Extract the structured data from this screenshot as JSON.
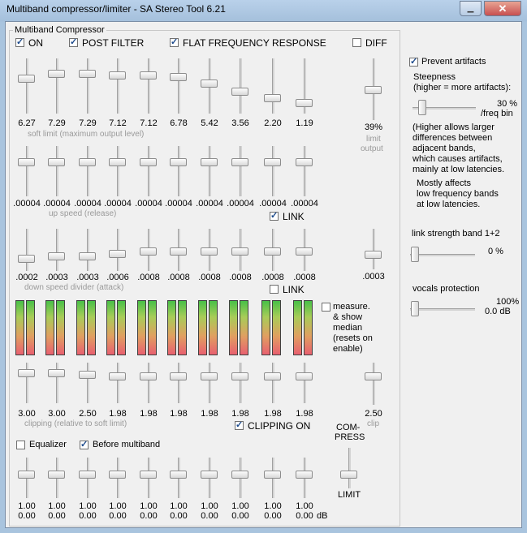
{
  "window": {
    "title": "Multiband compressor/limiter - SA Stereo Tool 6.21"
  },
  "group": {
    "title": "Multiband Compressor"
  },
  "top_checks": {
    "on": {
      "label": "ON",
      "checked": true
    },
    "post_filter": {
      "label": "POST FILTER",
      "checked": true
    },
    "flat": {
      "label": "FLAT FREQUENCY RESPONSE",
      "checked": true
    },
    "diff": {
      "label": "DIFF",
      "checked": false
    }
  },
  "soft_limit": {
    "values": [
      "6.27",
      "7.29",
      "7.29",
      "7.12",
      "7.12",
      "6.78",
      "5.42",
      "3.56",
      "2.20",
      "1.19"
    ],
    "caption": "soft limit (maximum output level)",
    "limit_output_value": "39%",
    "limit_output_caption_1": "limit",
    "limit_output_caption_2": "output"
  },
  "up_speed": {
    "values": [
      ".00004",
      ".00004",
      ".00004",
      ".00004",
      ".00004",
      ".00004",
      ".00004",
      ".00004",
      ".00004",
      ".00004"
    ],
    "caption": "up speed (release)",
    "link_label": "LINK",
    "link_checked": true
  },
  "down_speed": {
    "values": [
      ".0002",
      ".0003",
      ".0003",
      ".0006",
      ".0008",
      ".0008",
      ".0008",
      ".0008",
      ".0008",
      ".0008"
    ],
    "caption": "down speed divider (attack)",
    "extra_value": ".0003",
    "link_label": "LINK",
    "link_checked": false
  },
  "meters": {
    "measure_label_lines": [
      "measure.",
      "& show",
      "median",
      "(resets on",
      "enable)"
    ],
    "measure_checked": false
  },
  "clipping": {
    "values": [
      "3.00",
      "3.00",
      "2.50",
      "1.98",
      "1.98",
      "1.98",
      "1.98",
      "1.98",
      "1.98",
      "1.98"
    ],
    "caption": "clipping (relative to soft limit)",
    "clip_value": "2.50",
    "clip_caption": "clip",
    "clipping_on_label": "CLIPPING ON",
    "clipping_on_checked": true,
    "compress_label_1": "COM-",
    "compress_label_2": "PRESS",
    "limit_label": "LIMIT"
  },
  "equalizer": {
    "eq_label": "Equalizer",
    "eq_checked": false,
    "before_label": "Before multiband",
    "before_checked": true,
    "values_top": [
      "1.00",
      "1.00",
      "1.00",
      "1.00",
      "1.00",
      "1.00",
      "1.00",
      "1.00",
      "1.00",
      "1.00"
    ],
    "values_bottom": [
      "0.00",
      "0.00",
      "0.00",
      "0.00",
      "0.00",
      "0.00",
      "0.00",
      "0.00",
      "0.00",
      "0.00"
    ],
    "unit": "dB"
  },
  "right_panel": {
    "prevent_label": "Prevent artifacts",
    "prevent_checked": true,
    "steepness_lines": [
      "Steepness",
      "(higher = more artifacts):"
    ],
    "steepness_value": "30 %",
    "steepness_unit": "/freq bin",
    "steepness_level": 0.1,
    "info_lines": [
      "(Higher allows larger",
      "differences between",
      "adjacent bands,",
      "which causes artifacts,",
      "mainly at low latencies."
    ],
    "info2_lines": [
      "Mostly affects",
      "low frequency bands",
      "at low latencies."
    ],
    "link_strength_label": "link strength band 1+2",
    "link_strength_value": "0 %",
    "vocals_label": "vocals protection",
    "vocals_value": "100%",
    "vocals_db": "0.0 dB"
  }
}
